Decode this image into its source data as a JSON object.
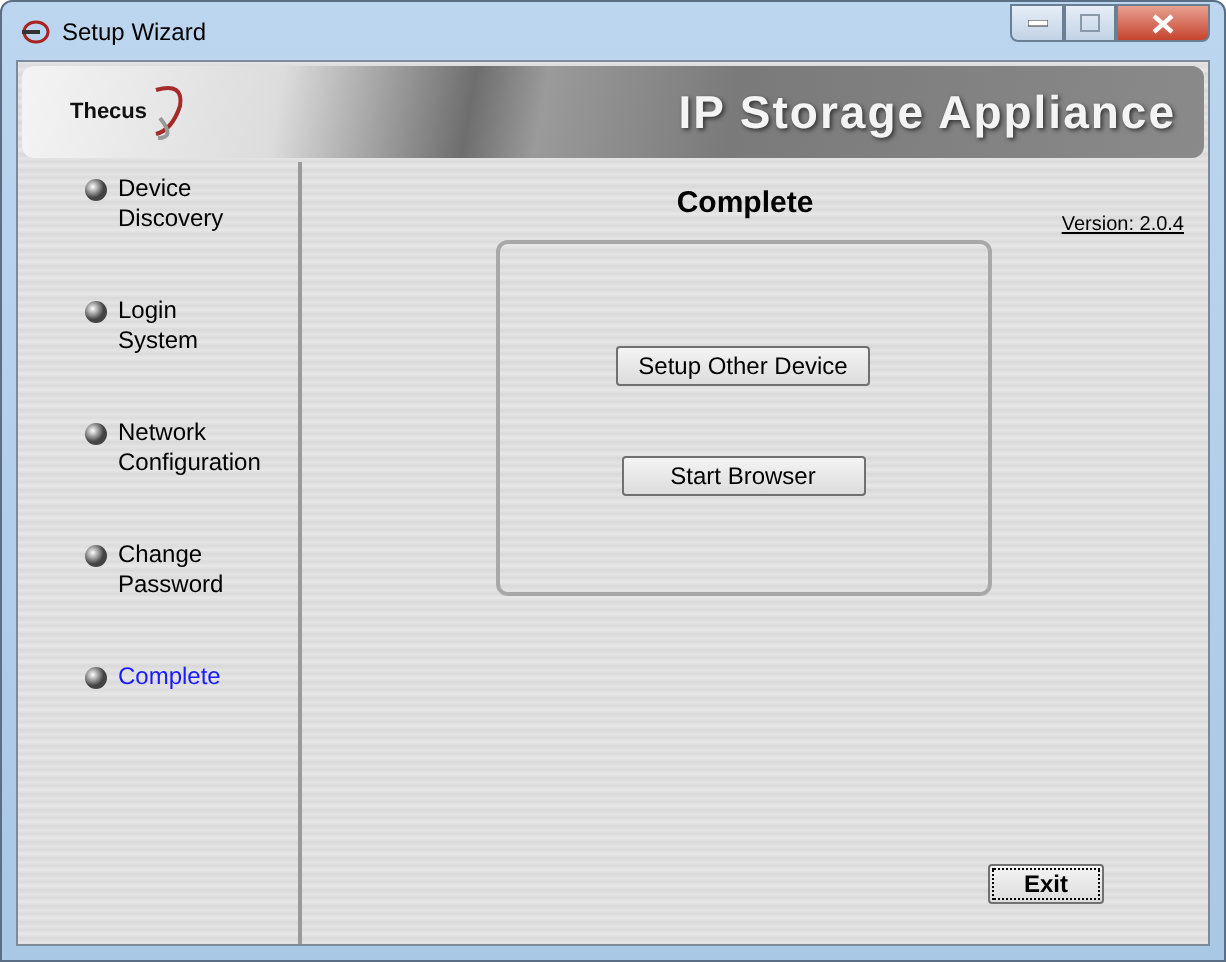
{
  "window": {
    "title": "Setup Wizard"
  },
  "banner": {
    "logo": "Thecus",
    "title": "IP Storage Appliance"
  },
  "steps": [
    {
      "label": "Device Discovery",
      "selected": false
    },
    {
      "label": "Login System",
      "selected": false
    },
    {
      "label": "Network Configuration",
      "selected": false
    },
    {
      "label": "Change Password",
      "selected": false
    },
    {
      "label": "Complete",
      "selected": true
    }
  ],
  "page": {
    "heading": "Complete",
    "version": "Version: 2.0.4",
    "buttons": [
      "Setup Other Device",
      "Start Browser"
    ]
  },
  "exit_button": "Exit"
}
